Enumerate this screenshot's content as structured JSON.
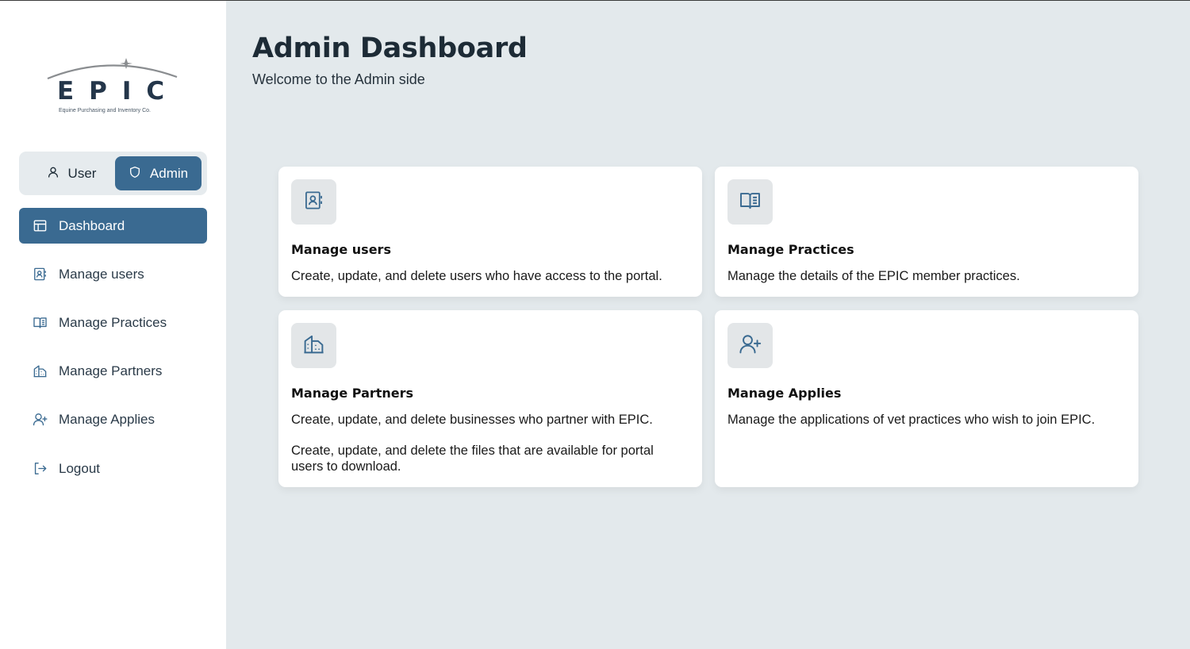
{
  "brand": {
    "name": "EPIC",
    "tagline": "Equine Purchasing and Inventory Co."
  },
  "role_toggle": {
    "user_label": "User",
    "admin_label": "Admin",
    "selected": "Admin"
  },
  "nav": {
    "items": [
      {
        "label": "Dashboard",
        "icon": "layout-icon",
        "active": true
      },
      {
        "label": "Manage users",
        "icon": "contact-book-icon"
      },
      {
        "label": "Manage Practices",
        "icon": "book-open-icon"
      },
      {
        "label": "Manage Partners",
        "icon": "building-icon"
      },
      {
        "label": "Manage Applies",
        "icon": "user-plus-icon"
      },
      {
        "label": "Logout",
        "icon": "logout-icon"
      }
    ]
  },
  "header": {
    "title": "Admin Dashboard",
    "subtitle": "Welcome to the Admin side"
  },
  "cards": [
    {
      "title": "Manage users",
      "icon": "contact-book-icon",
      "description": "Create, update, and delete users who have access to the portal."
    },
    {
      "title": "Manage Practices",
      "icon": "book-open-icon",
      "description": "Manage the details of the EPIC member practices."
    },
    {
      "title": "Manage Partners",
      "icon": "building-icon",
      "description": "Create, update, and delete businesses who partner with EPIC.",
      "description_extra": "Create, update, and delete the files that are available for portal users to download."
    },
    {
      "title": "Manage Applies",
      "icon": "user-plus-icon",
      "description": "Manage the applications of vet practices who wish to join EPIC."
    }
  ],
  "colors": {
    "accent": "#3a6a91",
    "background": "#e3e9ec",
    "sidebar": "#ffffff",
    "icon_tile": "#e3e6e8"
  }
}
